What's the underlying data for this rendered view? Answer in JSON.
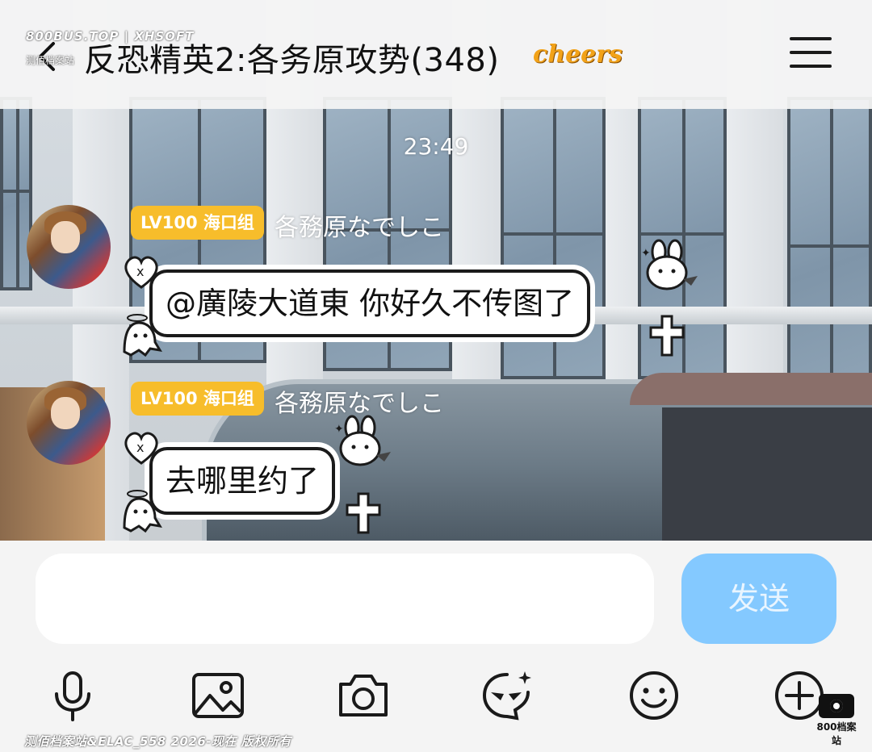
{
  "header": {
    "title": "反恐精英2:各务原攻势(348)",
    "sticker_text": "cheers",
    "watermark_line1": "800BUS.TOP | XHSOFT",
    "watermark_line2": "测佰档案站"
  },
  "chat": {
    "timestamp": "23:49",
    "messages": [
      {
        "level_badge": "LV100 海口组",
        "sender": "各務原なでしこ",
        "text": "@廣陵大道東 你好久不传图了"
      },
      {
        "level_badge": "LV100 海口组",
        "sender": "各務原なでしこ",
        "text": "去哪里约了"
      }
    ]
  },
  "composer": {
    "input_value": "",
    "send_label": "发送"
  },
  "toolbar": {
    "icons": [
      "microphone-icon",
      "image-icon",
      "camera-icon",
      "magic-sticker-icon",
      "emoji-icon",
      "plus-icon"
    ]
  },
  "footer": {
    "watermark": "测佰档案站&ELAC_558 2026-现在 版权所有",
    "logo_text": "800档案站"
  },
  "colors": {
    "level_badge": "#f7bd2b",
    "send_button": "#84c9ff",
    "header_bg": "#f4f4f4"
  }
}
